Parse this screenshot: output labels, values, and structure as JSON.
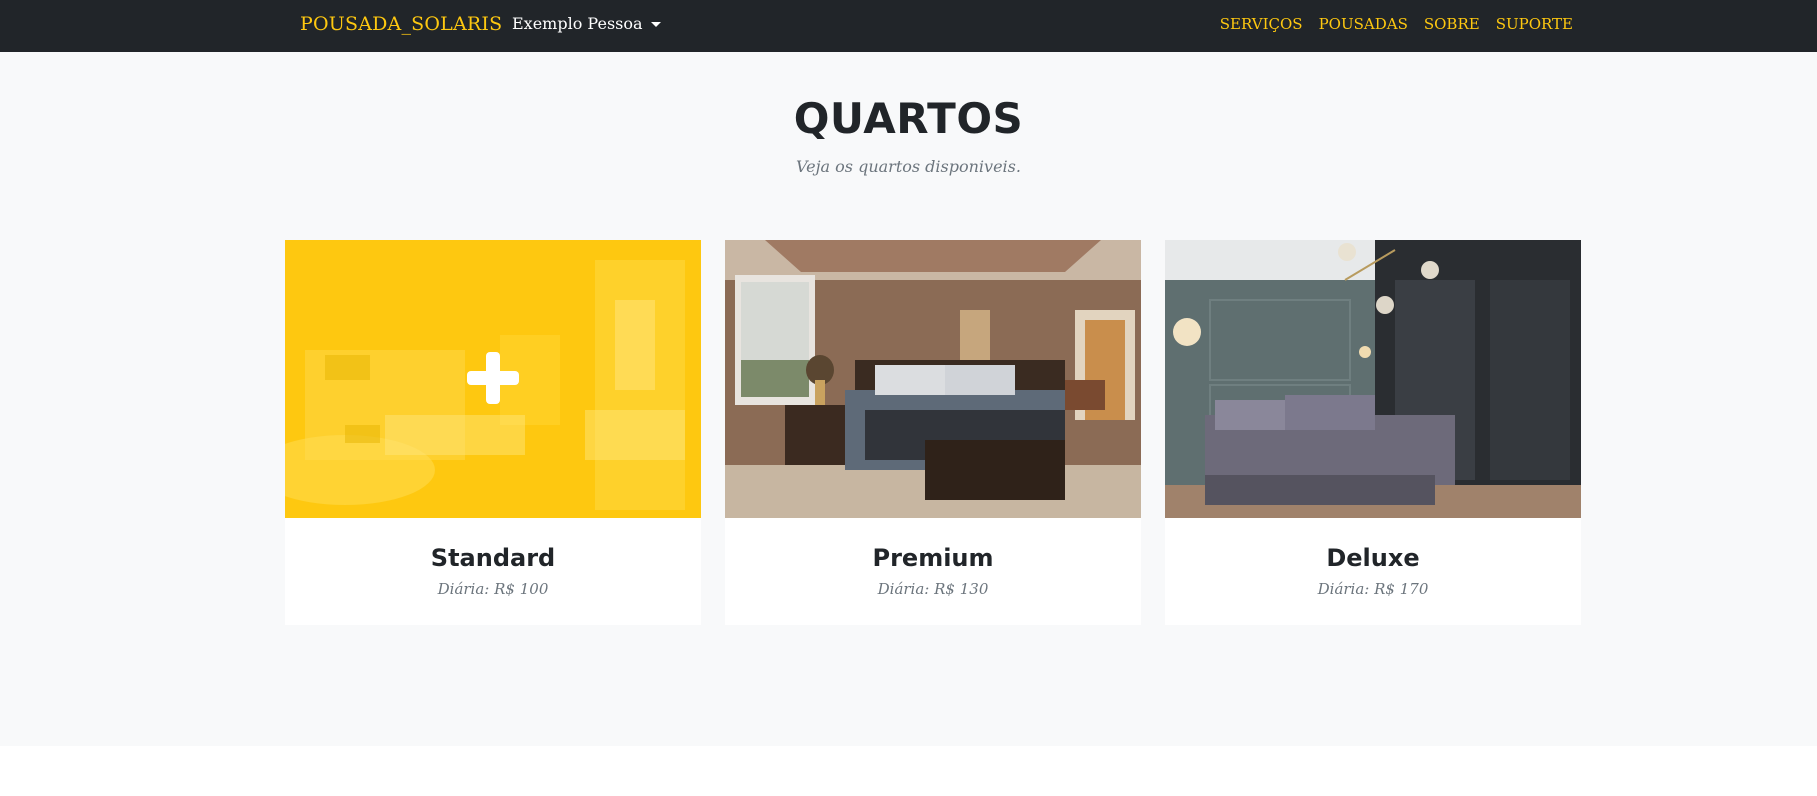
{
  "navbar": {
    "brand": "POUSADA_SOLARIS",
    "user_menu": "Exemplo Pessoa",
    "links": [
      "SERVIÇOS",
      "POUSADAS",
      "SOBRE",
      "SUPORTE"
    ]
  },
  "section": {
    "title": "QUARTOS",
    "subtitle": "Veja os quartos disponiveis."
  },
  "rooms": [
    {
      "name": "Standard",
      "price": "Diária: R$ 100",
      "image": "bedroom-photo-with-yellow-overlay",
      "icon": "plus-icon"
    },
    {
      "name": "Premium",
      "price": "Diária: R$ 130",
      "image": "bedroom-photo-dark-wood-bed"
    },
    {
      "name": "Deluxe",
      "price": "Diária: R$ 170",
      "image": "bedroom-photo-grey-walls"
    }
  ],
  "colors": {
    "accent": "#fec810",
    "navbar_bg": "#212529",
    "section_bg": "#f8f9fa",
    "title_text": "#212529",
    "muted_text": "#6c757d"
  }
}
